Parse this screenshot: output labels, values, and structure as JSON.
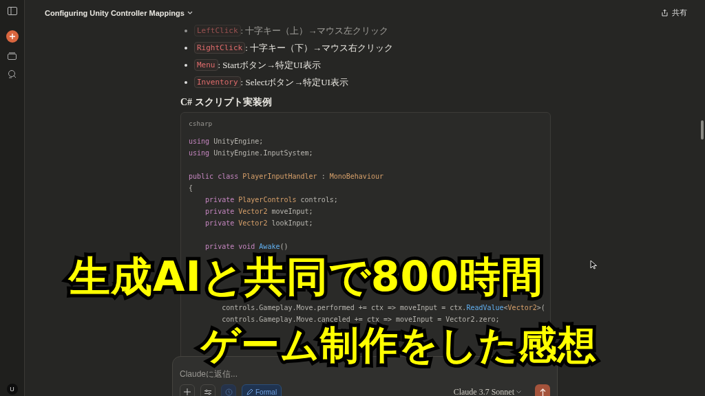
{
  "header": {
    "title": "Configuring Unity Controller Mappings",
    "share": "共有"
  },
  "sidebar": {
    "avatar": "U"
  },
  "bullets": [
    {
      "code": "LeftClick",
      "text": ": 十字キー（上）→マウス左クリック"
    },
    {
      "code": "RightClick",
      "text": ": 十字キー（下）→マウス右クリック"
    },
    {
      "code": "Menu",
      "text": ": Startボタン→特定UI表示"
    },
    {
      "code": "Inventory",
      "text": ": Selectボタン→特定UI表示"
    }
  ],
  "heading": "C# スクリプト実装例",
  "code_block": {
    "language": "csharp",
    "groups": [
      [
        [
          {
            "t": "using",
            "kind": "keyword"
          },
          {
            "t": " UnityEngine;",
            "kind": "plain"
          }
        ],
        [
          {
            "t": "using",
            "kind": "keyword"
          },
          {
            "t": " UnityEngine.InputSystem;",
            "kind": "plain"
          }
        ]
      ],
      [
        [
          {
            "t": "public class",
            "kind": "keyword"
          },
          {
            "t": " PlayerInputHandler",
            "kind": "type"
          },
          {
            "t": " : ",
            "kind": "plain"
          },
          {
            "t": "MonoBehaviour",
            "kind": "type"
          }
        ],
        [
          {
            "t": "{",
            "kind": "plain"
          }
        ],
        [
          {
            "t": "    private",
            "kind": "keyword"
          },
          {
            "t": " PlayerControls",
            "kind": "type"
          },
          {
            "t": " controls;",
            "kind": "plain"
          }
        ],
        [
          {
            "t": "    private",
            "kind": "keyword"
          },
          {
            "t": " Vector2",
            "kind": "type"
          },
          {
            "t": " moveInput;",
            "kind": "plain"
          }
        ],
        [
          {
            "t": "    private",
            "kind": "keyword"
          },
          {
            "t": " Vector2",
            "kind": "type"
          },
          {
            "t": " lookInput;",
            "kind": "plain"
          }
        ]
      ],
      [
        [
          {
            "t": "    private void",
            "kind": "keyword"
          },
          {
            "t": " Awake",
            "kind": "func"
          },
          {
            "t": "()",
            "kind": "plain"
          }
        ]
      ],
      [
        [
          {
            "t": "        controls.Gameplay.Move.performed += ctx => moveInput = ctx.",
            "kind": "plain"
          },
          {
            "t": "ReadValue",
            "kind": "func"
          },
          {
            "t": "<",
            "kind": "plain"
          },
          {
            "t": "Vector2",
            "kind": "type"
          },
          {
            "t": ">(",
            "kind": "plain"
          }
        ],
        [
          {
            "t": "        controls.Gameplay.Move.canceled += ctx => moveInput = Vector2.zero;",
            "kind": "plain"
          }
        ]
      ]
    ]
  },
  "composer": {
    "placeholder": "Claudeに返信...",
    "style_button": "Formal",
    "model": "Claude 3.7 Sonnet"
  },
  "overlay": {
    "lines": [
      "生成AIと共同で800時間",
      "ゲーム制作をした感想"
    ]
  }
}
